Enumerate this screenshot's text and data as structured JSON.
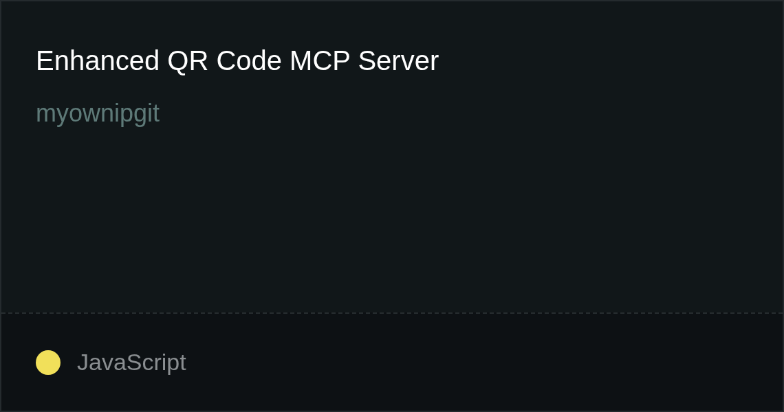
{
  "card": {
    "title": "Enhanced QR Code MCP Server",
    "author": "myownipgit"
  },
  "footer": {
    "language": {
      "name": "JavaScript",
      "color": "#f1e05a"
    }
  }
}
